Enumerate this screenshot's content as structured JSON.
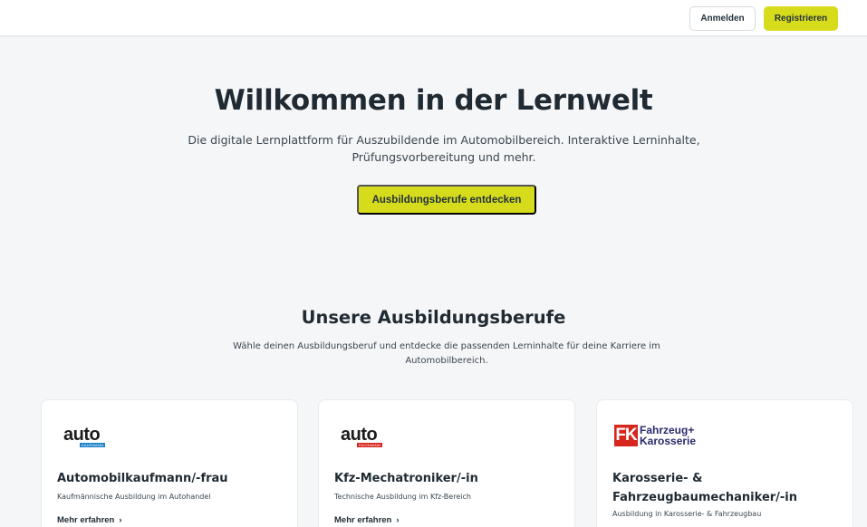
{
  "header": {
    "login_label": "Anmelden",
    "register_label": "Registrieren"
  },
  "hero": {
    "title": "Willkommen in der Lernwelt",
    "subtitle": "Die digitale Lernplattform für Auszubildende im Automobilbereich. Interaktive Lerninhalte, Prüfungsvorbereitung und mehr.",
    "cta_label": "Ausbildungsberufe entdecken"
  },
  "section": {
    "title": "Unsere Ausbildungsberufe",
    "subtitle": "Wähle deinen Ausbildungsberuf und entdecke die passenden Lerninhalte für deine Karriere im Automobilbereich."
  },
  "cards": [
    {
      "logo_word": "auto",
      "logo_tag": "KAUFMANN",
      "title": "Automobilkaufmann/-frau",
      "description": "Kaufmännische Ausbildung im Autohandel",
      "link_label": "Mehr erfahren"
    },
    {
      "logo_word": "auto",
      "logo_tag": "FACHMANN",
      "title": "Kfz-Mechatroniker/-in",
      "description": "Technische Ausbildung im Kfz-Bereich",
      "link_label": "Mehr erfahren"
    },
    {
      "logo_box": "FK",
      "logo_line1": "Fahrzeug+",
      "logo_line2": "Karosserie",
      "title": "Karosserie- & Fahrzeugbaumechaniker/-in",
      "description": "Ausbildung in Karosserie- & Fahrzeugbau",
      "link_label": "Mehr erfahren"
    }
  ],
  "colors": {
    "accent": "#d6dc1b",
    "background": "#f5f6f7",
    "text": "#1f2a33"
  },
  "icons": {
    "link_chevron": "chevron-right-icon"
  }
}
